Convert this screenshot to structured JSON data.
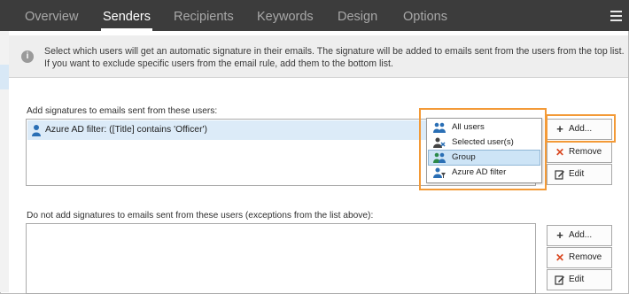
{
  "nav": {
    "tabs": [
      "Overview",
      "Senders",
      "Recipients",
      "Keywords",
      "Design",
      "Options"
    ],
    "active_tab": "Senders"
  },
  "info": {
    "text": "Select which users will get an automatic signature in their emails. The signature will be added to emails sent from the users from the top list. If you want to exclude specific users from the email rule, add them to the bottom list."
  },
  "include_section": {
    "label": "Add signatures to emails sent from these users:",
    "items": [
      "Azure AD filter: ([Title] contains 'Officer')"
    ],
    "buttons": {
      "add": "Add...",
      "remove": "Remove",
      "edit": "Edit"
    }
  },
  "add_menu": {
    "items": [
      "All users",
      "Selected user(s)",
      "Group",
      "Azure AD filter"
    ],
    "highlighted": "Group"
  },
  "exclude_section": {
    "label": "Do not add signatures to emails sent from these users (exceptions from the list above):",
    "items": [],
    "buttons": {
      "add": "Add...",
      "remove": "Remove",
      "edit": "Edit"
    }
  },
  "colors": {
    "nav_bg": "#3c3c3c",
    "accent_highlight": "#f39a37",
    "selected_row": "#dcebf8"
  },
  "icons": [
    "menu-icon",
    "info-icon",
    "user-icon",
    "plus-icon",
    "remove-x-icon",
    "edit-icon",
    "all-users-icon",
    "selected-users-icon",
    "group-icon",
    "azure-filter-icon"
  ]
}
